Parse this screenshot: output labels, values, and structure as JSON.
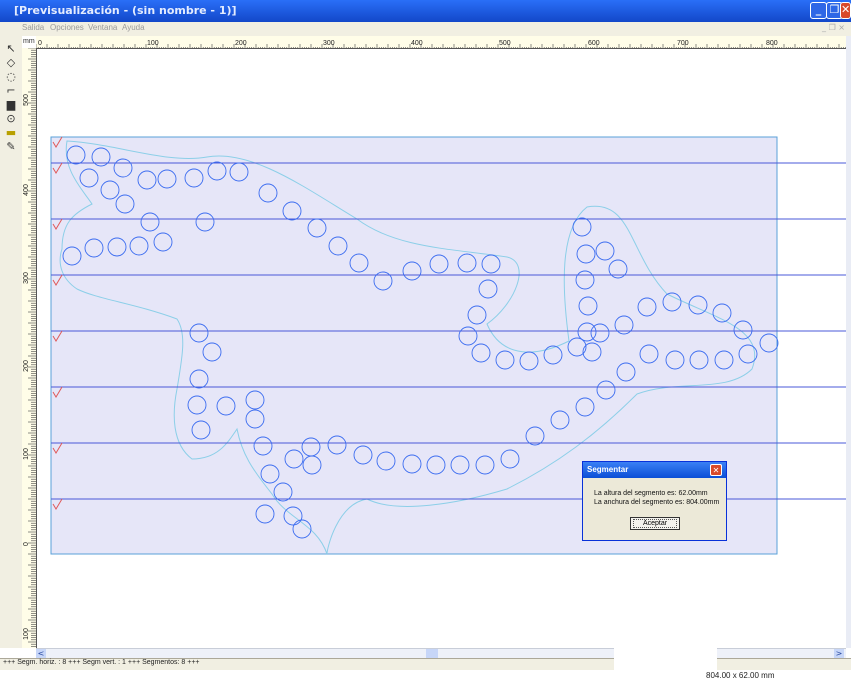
{
  "window": {
    "title": "[Previsualización - (sin nombre - 1)]",
    "min_glyph": "_",
    "max_glyph": "❐",
    "close_glyph": "✕"
  },
  "menu": {
    "items": [
      "Salida",
      "Opciones",
      "Ventana",
      "Ayuda"
    ],
    "right_controls": "_ ❐ ×"
  },
  "ruler": {
    "unit": "mm",
    "top_labels": [
      "0",
      "100",
      "200",
      "300",
      "400",
      "500",
      "600",
      "700",
      "800"
    ],
    "left_labels": [
      "500",
      "400",
      "300",
      "200",
      "100",
      "0",
      "100"
    ]
  },
  "toolbar": {
    "tools": [
      "pointer-icon",
      "lasso-icon",
      "lasso-curve-icon",
      "corner-icon",
      "fill-icon",
      "zoom-icon",
      "ruler-icon",
      "eyedropper-icon"
    ]
  },
  "scroll": {
    "left_arrow": "<",
    "right_arrow": ">"
  },
  "status": {
    "text": "+++ Segm. horiz. : 8 +++ Segm vert. : 1 +++ Segmentos: 8 +++",
    "dimensions": "804.00 x 62.00 mm"
  },
  "dialog": {
    "title": "Segmentar",
    "line1": "La altura del segmento es: 62.00mm",
    "line2": "La anchura del segmento es: 804.00mm",
    "ok_label": "Aceptar"
  },
  "colors": {
    "title_bar": "#2a6ff7",
    "canvas_fill": "#e6e6f8",
    "circle_stroke": "#3b6cf0",
    "outline": "#8ccfe8",
    "segment_line": "#4a58d8",
    "check_mark": "#e05a5a"
  }
}
